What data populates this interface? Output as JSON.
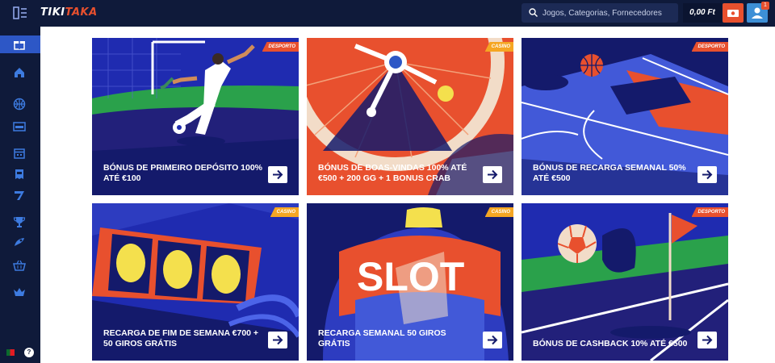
{
  "header": {
    "logo_part1": "TIKI",
    "logo_part2": "TAKA",
    "search_placeholder": "Jogos, Categorias, Fornecedores",
    "balance": "0,00 Ft",
    "notification_count": "1"
  },
  "sidebar": {
    "items": [
      {
        "icon": "gift-icon",
        "active": true
      },
      {
        "icon": "home-icon"
      },
      {
        "icon": "basketball-icon"
      },
      {
        "icon": "live-tv-icon"
      },
      {
        "icon": "calendar-icon"
      },
      {
        "icon": "ticket-icon"
      },
      {
        "icon": "seven-icon"
      },
      {
        "icon": "trophy-icon"
      },
      {
        "icon": "rocket-icon"
      },
      {
        "icon": "basket-icon"
      },
      {
        "icon": "crown-icon"
      }
    ],
    "help_label": "?"
  },
  "promotions": [
    {
      "tag": "DESPORTO",
      "type": "sport",
      "title": "BÓNUS DE PRIMEIRO DEPÓSITO 100% ATÉ €100"
    },
    {
      "tag": "CASINO",
      "type": "casino",
      "title": "BÓNUS DE BOAS-VINDAS 100% ATÉ €500 + 200 GG + 1 BONUS CRAB"
    },
    {
      "tag": "DESPORTO",
      "type": "sport",
      "title": "BÓNUS DE RECARGA SEMANAL 50% ATÉ €500"
    },
    {
      "tag": "CASINO",
      "type": "casino",
      "title": "RECARGA DE FIM DE SEMANA €700 + 50 GIROS GRÁTIS"
    },
    {
      "tag": "CASINO",
      "type": "casino",
      "title": "RECARGA SEMANAL 50 GIROS GRÁTIS",
      "art_text": "SLOT"
    },
    {
      "tag": "DESPORTO",
      "type": "sport",
      "title": "BÓNUS DE CASHBACK 10% ATÉ €500"
    }
  ],
  "colors": {
    "topbar": "#0f1a3a",
    "accent_orange": "#e8502e",
    "accent_yellow": "#f5a623",
    "user_blue": "#3d8fd6",
    "card_navy": "#141a6b"
  }
}
